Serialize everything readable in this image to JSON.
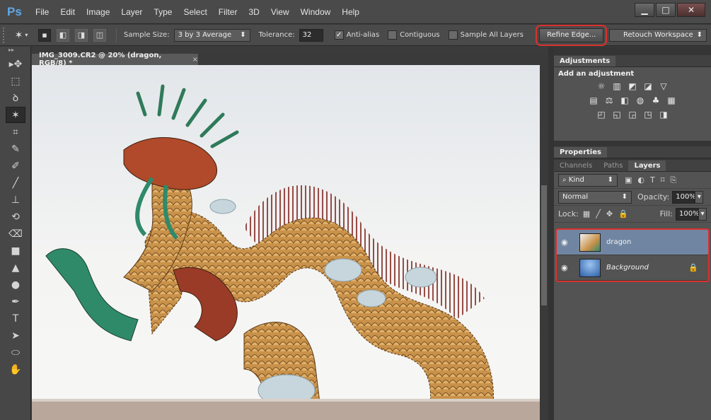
{
  "app": {
    "logo": "Ps"
  },
  "menu": [
    "File",
    "Edit",
    "Image",
    "Layer",
    "Type",
    "Select",
    "Filter",
    "3D",
    "View",
    "Window",
    "Help"
  ],
  "window_controls": {
    "minimize": "▁",
    "maximize": "□",
    "close": "✕"
  },
  "options": {
    "sample_size_label": "Sample Size:",
    "sample_size_value": "3 by 3 Average",
    "tolerance_label": "Tolerance:",
    "tolerance_value": "32",
    "anti_alias_label": "Anti-alias",
    "anti_alias_checked": true,
    "contiguous_label": "Contiguous",
    "contiguous_checked": false,
    "sample_all_label": "Sample All Layers",
    "sample_all_checked": false,
    "refine_edge_label": "Refine Edge...",
    "workspace_value": "Retouch Workspace"
  },
  "document": {
    "tab_title": "IMG_3009.CR2 @ 20% (dragon, RGB/8) *",
    "close": "×"
  },
  "tools": [
    {
      "icon": "move-icon",
      "glyph": "▸✥"
    },
    {
      "icon": "marquee-icon",
      "glyph": "⬚"
    },
    {
      "icon": "lasso-icon",
      "glyph": "ꝺ"
    },
    {
      "icon": "magic-wand-icon",
      "glyph": "✶",
      "active": true
    },
    {
      "icon": "crop-icon",
      "glyph": "⌗"
    },
    {
      "icon": "eyedropper-icon",
      "glyph": "✎"
    },
    {
      "icon": "healing-brush-icon",
      "glyph": "✐"
    },
    {
      "icon": "brush-icon",
      "glyph": "╱"
    },
    {
      "icon": "clone-stamp-icon",
      "glyph": "⊥"
    },
    {
      "icon": "history-brush-icon",
      "glyph": "⟲"
    },
    {
      "icon": "eraser-icon",
      "glyph": "⌫"
    },
    {
      "icon": "gradient-icon",
      "glyph": "■"
    },
    {
      "icon": "blur-icon",
      "glyph": "▲"
    },
    {
      "icon": "dodge-icon",
      "glyph": "●"
    },
    {
      "icon": "pen-icon",
      "glyph": "✒"
    },
    {
      "icon": "type-icon",
      "glyph": "T"
    },
    {
      "icon": "path-selection-icon",
      "glyph": "➤"
    },
    {
      "icon": "ellipse-icon",
      "glyph": "⬭"
    },
    {
      "icon": "hand-icon",
      "glyph": "✋"
    }
  ],
  "adjustments": {
    "tab": "Adjustments",
    "title": "Add an adjustment",
    "row1": [
      "☼",
      "▥",
      "◩",
      "◪",
      "▽"
    ],
    "row2": [
      "▤",
      "⚖",
      "◧",
      "◍",
      "♣",
      "▦"
    ],
    "row3": [
      "◰",
      "◱",
      "◲",
      "◳",
      "◨"
    ]
  },
  "properties": {
    "tab": "Properties"
  },
  "layers_panel": {
    "tabs": [
      "Channels",
      "Paths",
      "Layers"
    ],
    "kind_label": "Kind",
    "kind_icons": [
      "▣",
      "◐",
      "T",
      "⌑",
      "⎘"
    ],
    "blend_mode": "Normal",
    "opacity_label": "Opacity:",
    "opacity_value": "100%",
    "lock_label": "Lock:",
    "lock_icons": [
      "▦",
      "╱",
      "✥",
      "🔒"
    ],
    "fill_label": "Fill:",
    "fill_value": "100%",
    "layers": [
      {
        "name": "dragon",
        "selected": true,
        "visible": true
      },
      {
        "name": "Background",
        "selected": false,
        "visible": true,
        "locked": true
      }
    ]
  },
  "colors": {
    "accent_highlight": "#d9312d",
    "selected_layer": "#7085a1",
    "ps_logo": "#5fa8ea"
  }
}
